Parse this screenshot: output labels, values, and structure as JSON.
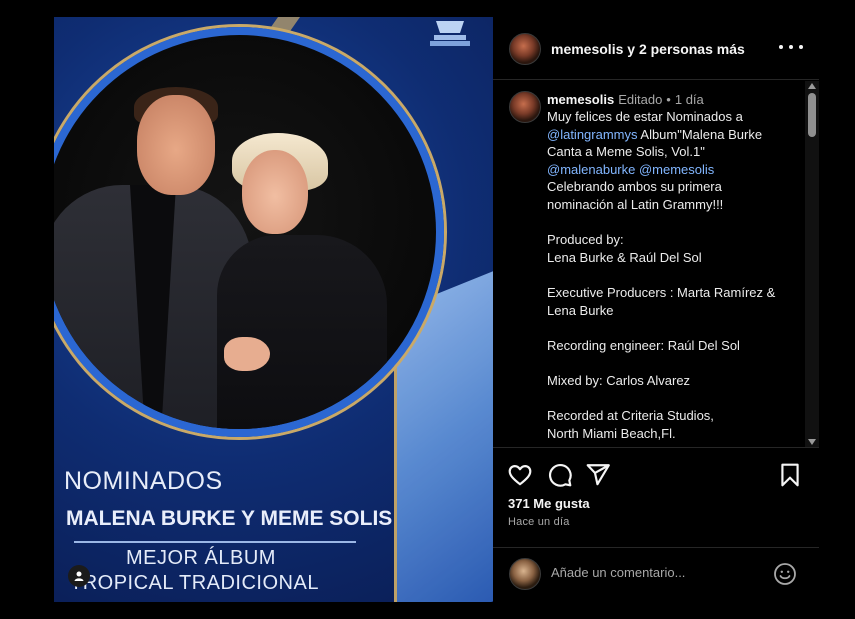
{
  "post_image": {
    "overlay": {
      "heading": "NOMINADOS",
      "names": "MALENA BURKE Y MEME SOLIS",
      "category_line1": "MEJOR ÁLBUM",
      "category_line2": "TROPICAL TRADICIONAL"
    },
    "icons": {
      "trophy": "gramophone-trophy-icon",
      "tag": "user-tag-icon"
    },
    "colors": {
      "background_blue": "#0f2d73",
      "accent_blue": "#2b67d2",
      "gold": "#c9a968"
    }
  },
  "header": {
    "username": "memesolis",
    "coauthors": " y 2 personas más",
    "more_icon": "more-horizontal-icon"
  },
  "caption": {
    "username": "memesolis",
    "edited": "Editado",
    "separator": "•",
    "time": "1 día",
    "lines": [
      "Muy felices de estar Nominados a",
      "@latingrammys",
      " Album\"Malena Burke",
      "Canta a Meme Solis, Vol.1\"",
      "@malenaburke @memesolis",
      "Celebrando ambos su primera",
      "nominación al Latin Grammy!!!",
      "Produced by:",
      "Lena Burke & Raúl Del Sol",
      "Executive Producers : Marta Ramírez &",
      "Lena Burke",
      "Recording engineer: Raúl Del Sol",
      "Mixed by: Carlos Alvarez",
      "Recorded at Criteria Studios,",
      "North Miami Beach,Fl."
    ]
  },
  "actions": {
    "like_icon": "heart-icon",
    "comment_icon": "comment-icon",
    "share_icon": "send-icon",
    "save_icon": "bookmark-icon",
    "likes": "371 Me gusta",
    "ago": "Hace un día"
  },
  "comment": {
    "placeholder": "Añade un comentario...",
    "emoji_icon": "emoji-icon"
  },
  "colors": {
    "mention": "#82b6ff",
    "panel_bg": "#000000",
    "muted": "#a8a8a8"
  }
}
